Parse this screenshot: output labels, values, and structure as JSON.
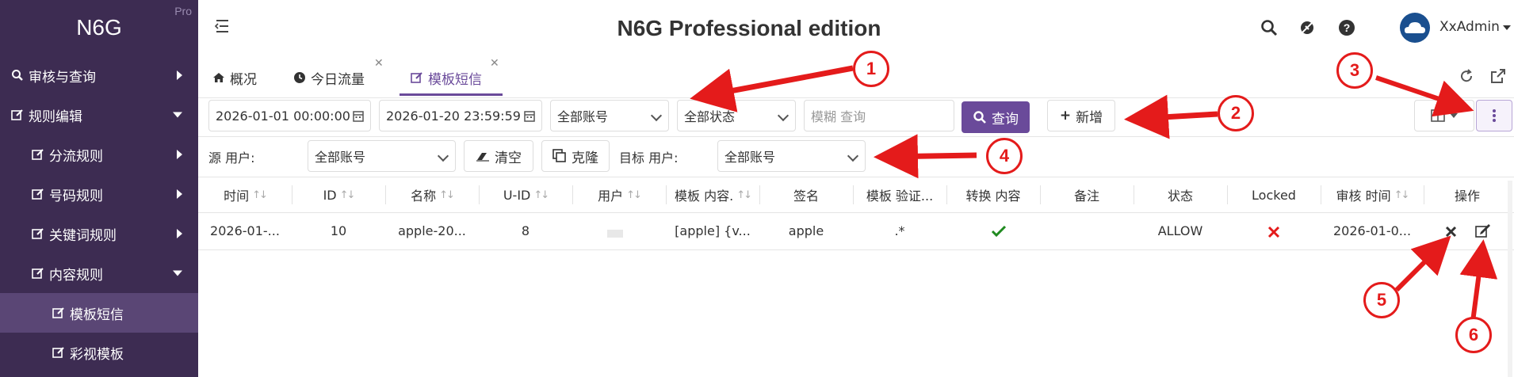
{
  "brand": {
    "name": "N6G",
    "badge": "Pro"
  },
  "sidebar": {
    "items": [
      {
        "label": "审核与查询"
      },
      {
        "label": "规则编辑"
      },
      {
        "label": "分流规则"
      },
      {
        "label": "号码规则"
      },
      {
        "label": "关键词规则"
      },
      {
        "label": "内容规则"
      },
      {
        "label": "模板短信"
      },
      {
        "label": "彩视模板"
      }
    ]
  },
  "header": {
    "title": "N6G Professional edition",
    "user": "XxAdmin"
  },
  "tabs": [
    {
      "label": "概况"
    },
    {
      "label": "今日流量"
    },
    {
      "label": "模板短信"
    }
  ],
  "toolbar": {
    "start_time": "2026-01-01 00:00:00",
    "end_time": "2026-01-20 23:59:59",
    "account_select": "全部账号",
    "status_select": "全部状态",
    "search_placeholder": "模糊 查询",
    "query_label": "查询",
    "add_label": "新增"
  },
  "filter": {
    "source_user_label": "源 用户:",
    "source_user_select": "全部账号",
    "clear_label": "清空",
    "clone_label": "克隆",
    "target_user_label": "目标 用户:",
    "target_user_select": "全部账号"
  },
  "table": {
    "headers": [
      "时间",
      "ID",
      "名称",
      "U-ID",
      "用户",
      "模板 内容.",
      "签名",
      "模板 验证...",
      "转换 内容",
      "备注",
      "状态",
      "Locked",
      "审核 时间",
      "操作"
    ],
    "rows": [
      {
        "time": "2026-01-...",
        "id": "10",
        "name": "apple-20...",
        "uid": "8",
        "user": "",
        "content": "[apple] {v...",
        "signature": "apple",
        "verify": ".*",
        "convert": "check",
        "note": "",
        "status": "ALLOW",
        "locked": "cross",
        "audit_time": "2026-01-0..."
      }
    ]
  },
  "annotations": [
    "1",
    "2",
    "3",
    "4",
    "5",
    "6"
  ],
  "colors": {
    "sidebar": "#3d2c52",
    "accent": "#6a4a9a",
    "annotation": "#e41b1b"
  }
}
